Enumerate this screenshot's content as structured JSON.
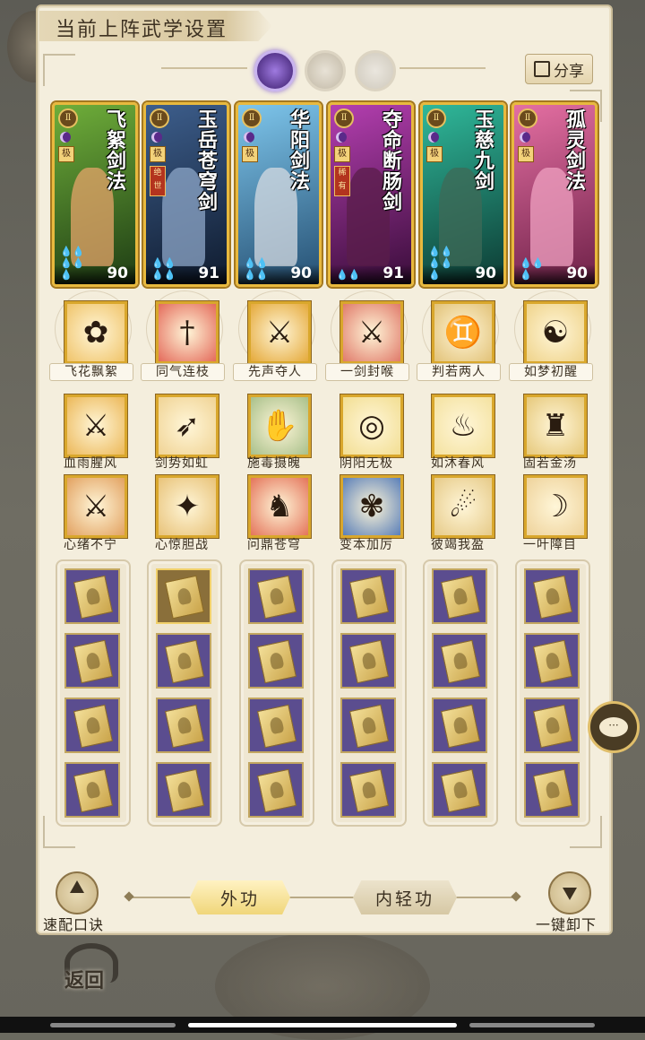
{
  "header": {
    "title": "当前上阵武学设置",
    "share_label": "分享"
  },
  "cards": [
    {
      "name": "飞絮剑法",
      "score": "90",
      "grade": "极",
      "tag": "",
      "bg": "#6fae3a",
      "bg2": "#1e3d14",
      "fig": "#e6a46a",
      "drops": "💧💧💧💧💧"
    },
    {
      "name": "玉岳苍穹剑",
      "score": "91",
      "grade": "极",
      "tag": "绝世",
      "bg": "#3d5e8c",
      "bg2": "#0f1b2e",
      "fig": "#8ea7c8",
      "drops": "💧💧💧💧"
    },
    {
      "name": "华阳剑法",
      "score": "90",
      "grade": "极",
      "tag": "",
      "bg": "#7ec6ec",
      "bg2": "#254f72",
      "fig": "#d5dbe2",
      "drops": "💧💧💧💧"
    },
    {
      "name": "夺命断肠剑",
      "score": "91",
      "grade": "极",
      "tag": "稀有",
      "bg": "#b43fb0",
      "bg2": "#3a0d3a",
      "fig": "#5a1d4a",
      "drops": "💧💧"
    },
    {
      "name": "玉慈九剑",
      "score": "90",
      "grade": "极",
      "tag": "",
      "bg": "#2fb89a",
      "bg2": "#0d3b33",
      "fig": "#3f6a57",
      "drops": "💧💧💧💧💧"
    },
    {
      "name": "孤灵剑法",
      "score": "90",
      "grade": "极",
      "tag": "",
      "bg": "#e46fa2",
      "bg2": "#6e2148",
      "fig": "#f0a2c2",
      "drops": "💧💧💧"
    }
  ],
  "skills_row1": [
    {
      "label": "飞花飘絮",
      "glyph": "✿",
      "bg": "#f0c46a"
    },
    {
      "label": "同气连枝",
      "glyph": "†",
      "bg": "#e46a5a"
    },
    {
      "label": "先声夺人",
      "glyph": "⚔",
      "bg": "#e5a93a"
    },
    {
      "label": "一剑封喉",
      "glyph": "⚔",
      "bg": "#e07a6a"
    },
    {
      "label": "判若两人",
      "glyph": "♊",
      "bg": "#e2c278"
    },
    {
      "label": "如梦初醒",
      "glyph": "☯",
      "bg": "#efd38a"
    }
  ],
  "skills_row2": [
    {
      "label": "血雨腥风",
      "glyph": "⚔",
      "bg": "#ecb858"
    },
    {
      "label": "剑势如虹",
      "glyph": "➶",
      "bg": "#f0d394"
    },
    {
      "label": "施毒摄魄",
      "glyph": "✋",
      "bg": "#a8c08a"
    },
    {
      "label": "阴阳无极",
      "glyph": "◎",
      "bg": "#f2de92"
    },
    {
      "label": "如沐春风",
      "glyph": "♨",
      "bg": "#f4e2a0"
    },
    {
      "label": "固若金汤",
      "glyph": "♜",
      "bg": "#e6c87a"
    }
  ],
  "skills_row3": [
    {
      "label": "心绪不宁",
      "glyph": "⚔",
      "bg": "#e2a160"
    },
    {
      "label": "心惊胆战",
      "glyph": "✦",
      "bg": "#e8c278"
    },
    {
      "label": "问鼎苍穹",
      "glyph": "♞",
      "bg": "#e4745a"
    },
    {
      "label": "变本加厉",
      "glyph": "✾",
      "bg": "#5a7fb8"
    },
    {
      "label": "彼竭我盈",
      "glyph": "☄",
      "bg": "#e6ca88"
    },
    {
      "label": "一叶障目",
      "glyph": "☽",
      "bg": "#eed29a"
    }
  ],
  "tabs": {
    "active": "外功",
    "inactive": "内轻功"
  },
  "buttons": {
    "quick_match": "速配口诀",
    "unload_all": "一键卸下",
    "back": "返回"
  },
  "chat": {
    "glyph": "···"
  }
}
